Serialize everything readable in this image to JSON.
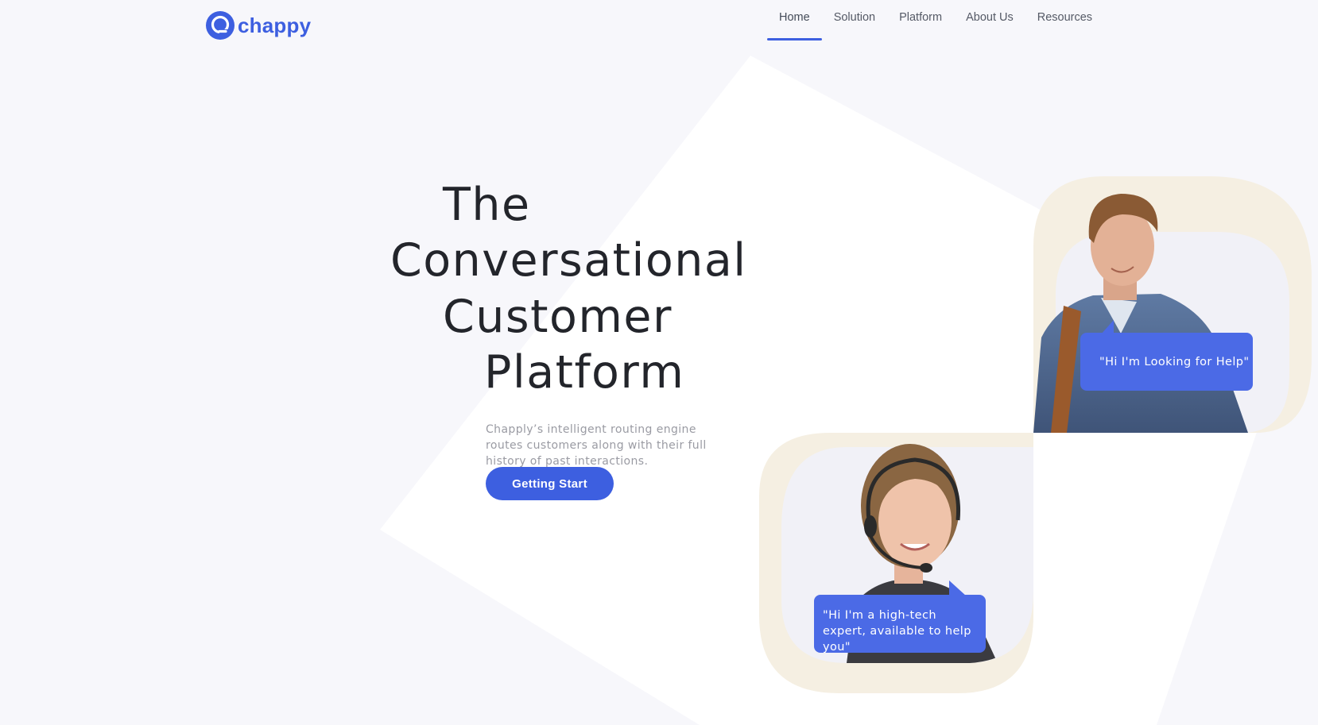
{
  "brand": {
    "name": "chappy",
    "logo_icon": "chat-bubble-logo-icon",
    "accent": "#3d5fe0",
    "background": "#f7f7fb"
  },
  "nav": {
    "items": [
      {
        "label": "Home",
        "active": true
      },
      {
        "label": "Solution",
        "active": false
      },
      {
        "label": "Platform",
        "active": false
      },
      {
        "label": "About Us",
        "active": false
      },
      {
        "label": "Resources",
        "active": false
      }
    ]
  },
  "hero": {
    "title_lines": [
      "The",
      "Conversational",
      "Customer",
      "Platform"
    ],
    "description": "Chapply’s intelligent routing engine routes customers along with their full history of past interactions.",
    "cta_label": "Getting Start"
  },
  "testimonials": {
    "customer_quote": "\"Hi I'm Looking for Help\"",
    "agent_quote": "\"Hi I'm a high-tech expert, available to help you\"",
    "frame_color": "#f5efe2",
    "bubble_color": "#4b6ae6"
  }
}
